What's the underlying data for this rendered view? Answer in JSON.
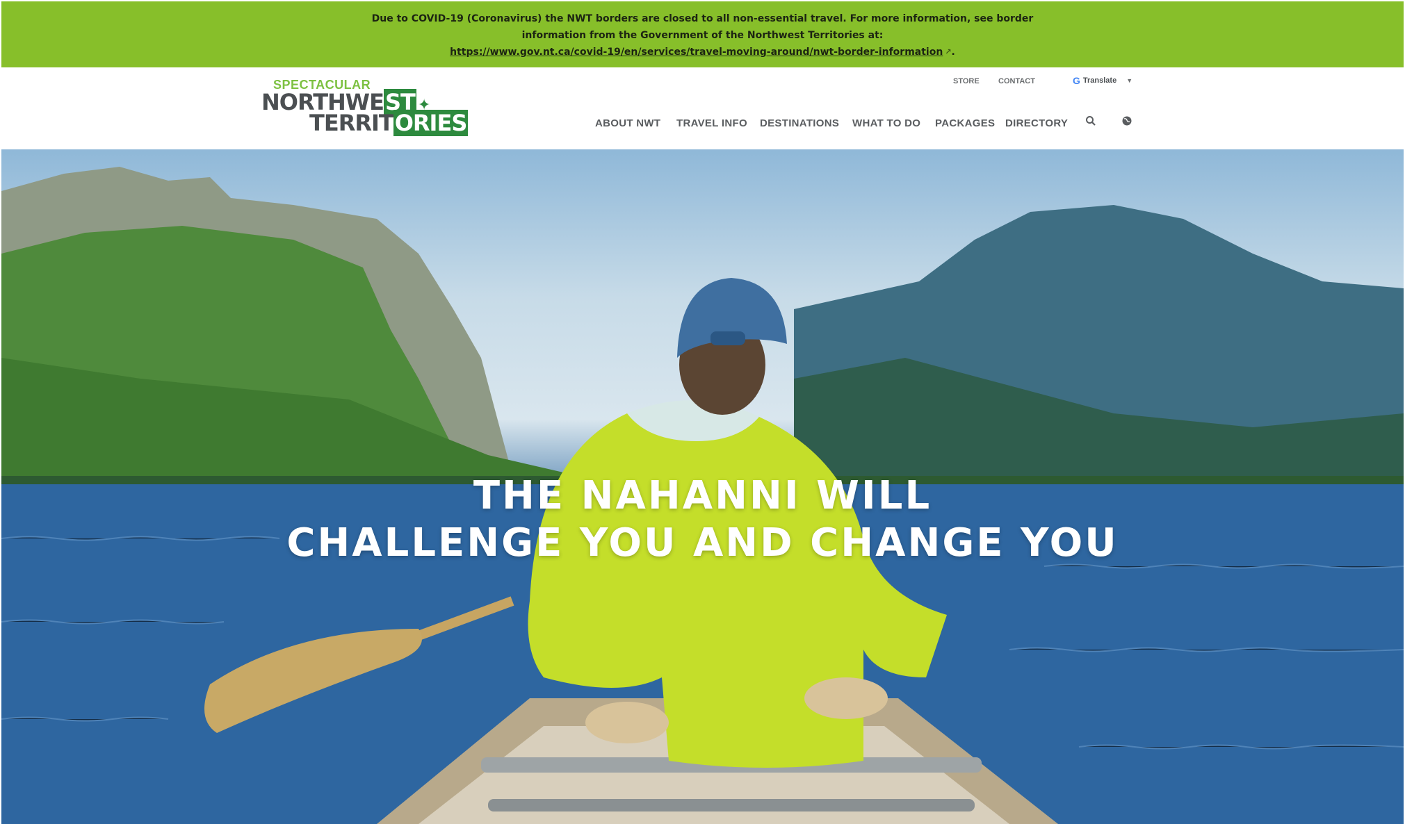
{
  "banner": {
    "line1": "Due to COVID-19 (Coronavirus) the NWT borders are closed to all non-essential travel. For more information, see border",
    "line2": "information from the Government of the Northwest Territories at:",
    "link": "https://www.gov.nt.ca/covid-19/en/services/travel-moving-around/nwt-border-information",
    "link_suffix": ".",
    "external_icon": "external-link-icon"
  },
  "logo": {
    "line_top": "SPECTACULAR",
    "line1_a": "NORTHWE",
    "line1_b": "ST",
    "line2_a": "TERRIT",
    "line2_b": "ORIES",
    "icon": "maple-leaf-icon"
  },
  "utility_nav": {
    "store": "STORE",
    "contact": "CONTACT",
    "translate": "Translate"
  },
  "main_nav": {
    "items": [
      "ABOUT NWT",
      "TRAVEL INFO",
      "DESTINATIONS",
      "WHAT TO DO",
      "PACKAGES",
      "DIRECTORY"
    ],
    "search_icon": "search-icon",
    "language_icon": "globe-icon"
  },
  "hero": {
    "headline_line1": "THE NAHANNI WILL",
    "headline_line2": "CHALLENGE YOU AND CHANGE YOU"
  },
  "colors": {
    "banner_bg": "#87bf2a",
    "brand_green": "#2d8a3e",
    "logo_light_green": "#7dc142",
    "nav_text": "#5a5d60"
  }
}
